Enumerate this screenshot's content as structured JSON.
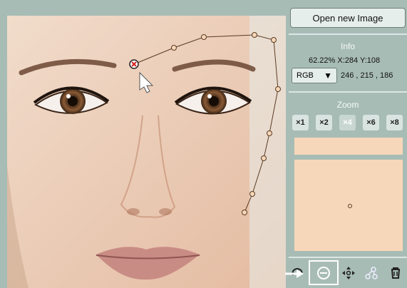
{
  "toolbar": {
    "open_label": "Open new Image"
  },
  "info": {
    "title": "Info",
    "readout": "62.22% X:284 Y:108",
    "mode": "RGB",
    "rgb": "246 , 215 , 186"
  },
  "zoom": {
    "title": "Zoom",
    "levels": [
      "×1",
      "×2",
      "×4",
      "×6",
      "×8"
    ],
    "active": "×4"
  },
  "colors": {
    "panel_bg": "#a8bcb6",
    "swatch": "#f7d7b9",
    "path_stroke": "#5a3b22"
  },
  "icons": {
    "tools": [
      "lasso-icon",
      "remove-point-icon",
      "move-icon",
      "nodes-icon",
      "trash-icon"
    ]
  }
}
